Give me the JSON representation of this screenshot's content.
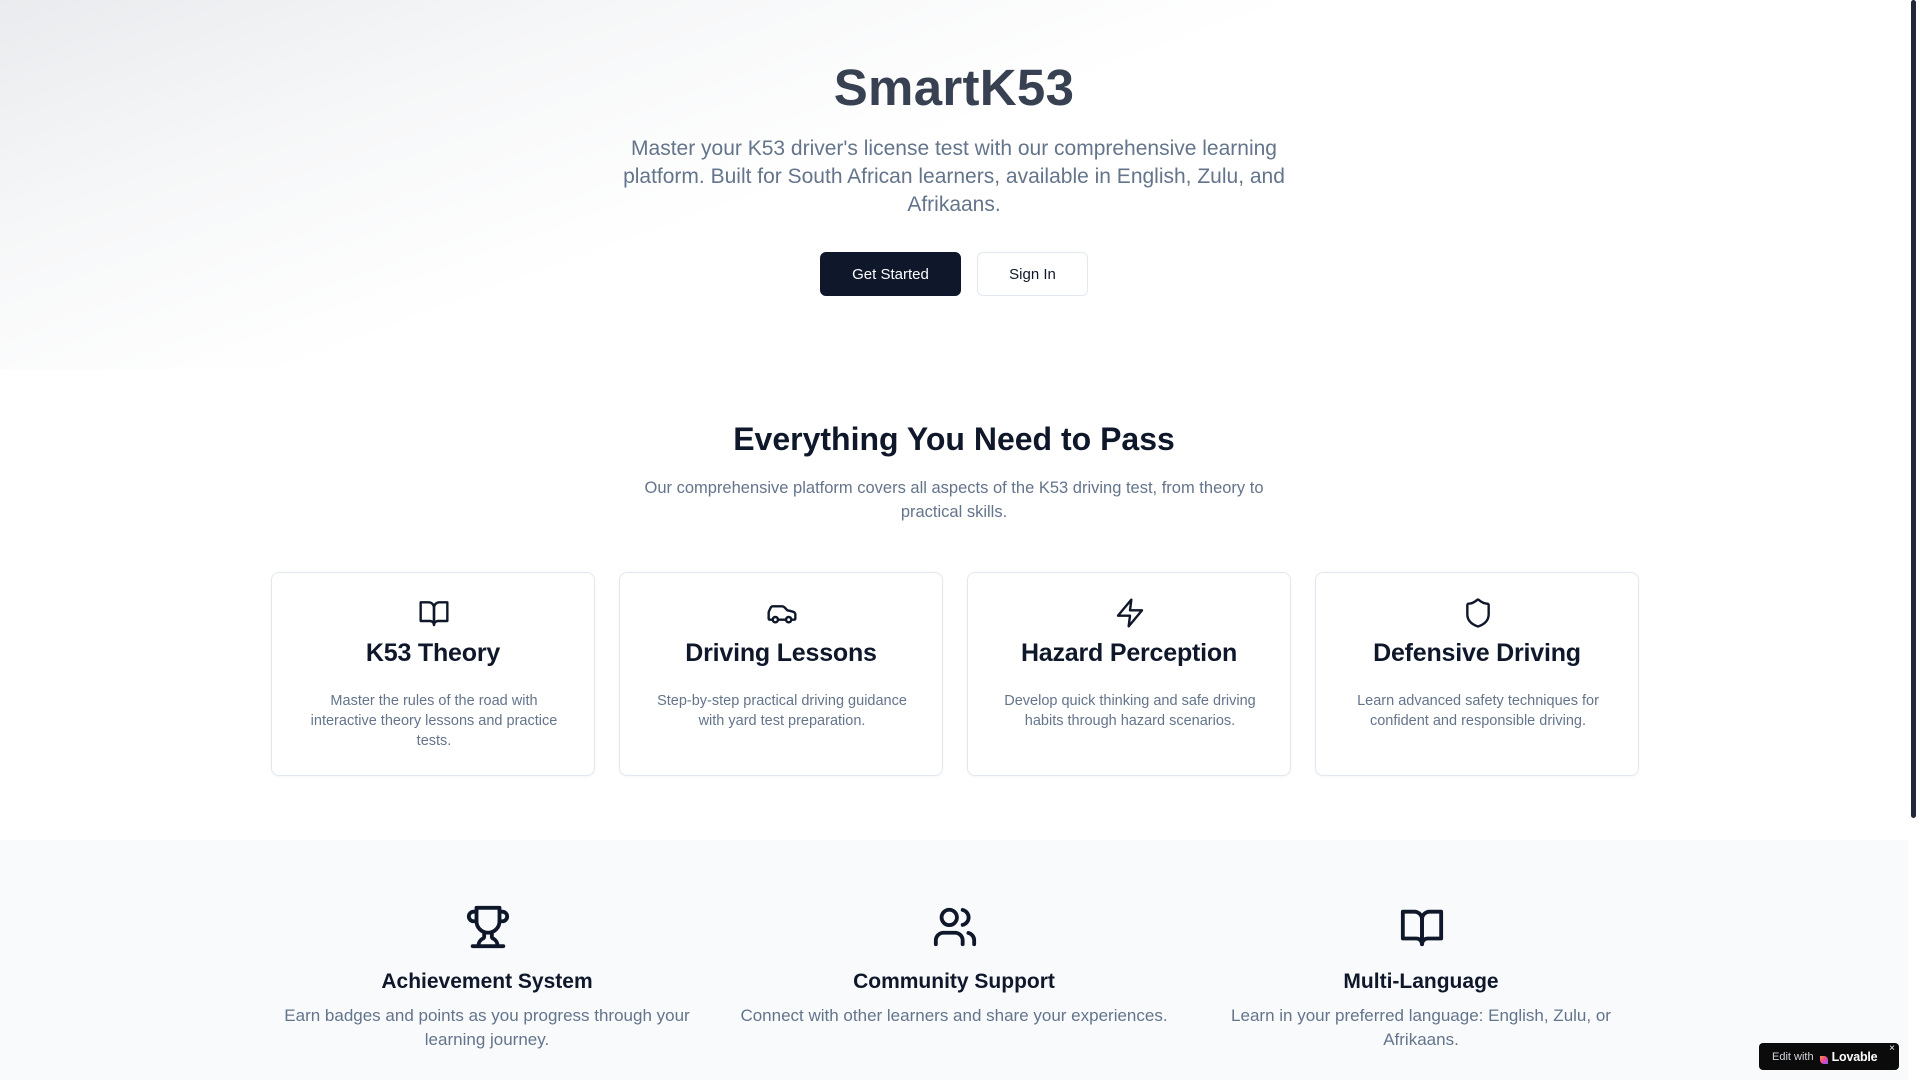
{
  "hero": {
    "title": "SmartK53",
    "subtitle": "Master your K53 driver's license test with our comprehensive learning platform. Built for South African learners, available in English, Zulu, and Afrikaans.",
    "primary_button": "Get Started",
    "secondary_button": "Sign In"
  },
  "features": {
    "title": "Everything You Need to Pass",
    "subtitle": "Our comprehensive platform covers all aspects of the K53 driving test, from theory to practical skills.",
    "cards": [
      {
        "icon": "book-open-icon",
        "title": "K53 Theory",
        "description": "Master the rules of the road with interactive theory lessons and practice tests."
      },
      {
        "icon": "car-icon",
        "title": "Driving Lessons",
        "description": "Step-by-step practical driving guidance with yard test preparation."
      },
      {
        "icon": "zap-icon",
        "title": "Hazard Perception",
        "description": "Develop quick thinking and safe driving habits through hazard scenarios."
      },
      {
        "icon": "shield-icon",
        "title": "Defensive Driving",
        "description": "Learn advanced safety techniques for confident and responsible driving."
      }
    ]
  },
  "highlights": [
    {
      "icon": "trophy-icon",
      "title": "Achievement System",
      "description": "Earn badges and points as you progress through your learning journey."
    },
    {
      "icon": "users-icon",
      "title": "Community Support",
      "description": "Connect with other learners and share your experiences."
    },
    {
      "icon": "book-open-icon",
      "title": "Multi-Language",
      "description": "Learn in your preferred language: English, Zulu, or Afrikaans."
    }
  ],
  "badge": {
    "edit_label": "Edit with",
    "brand": "Lovable",
    "close": "×"
  },
  "colors": {
    "primary": "#0f172a",
    "muted_text": "#64748b",
    "hero_title": "#374151",
    "border": "#e2e8f0",
    "section_bg": "#f8fafc"
  }
}
